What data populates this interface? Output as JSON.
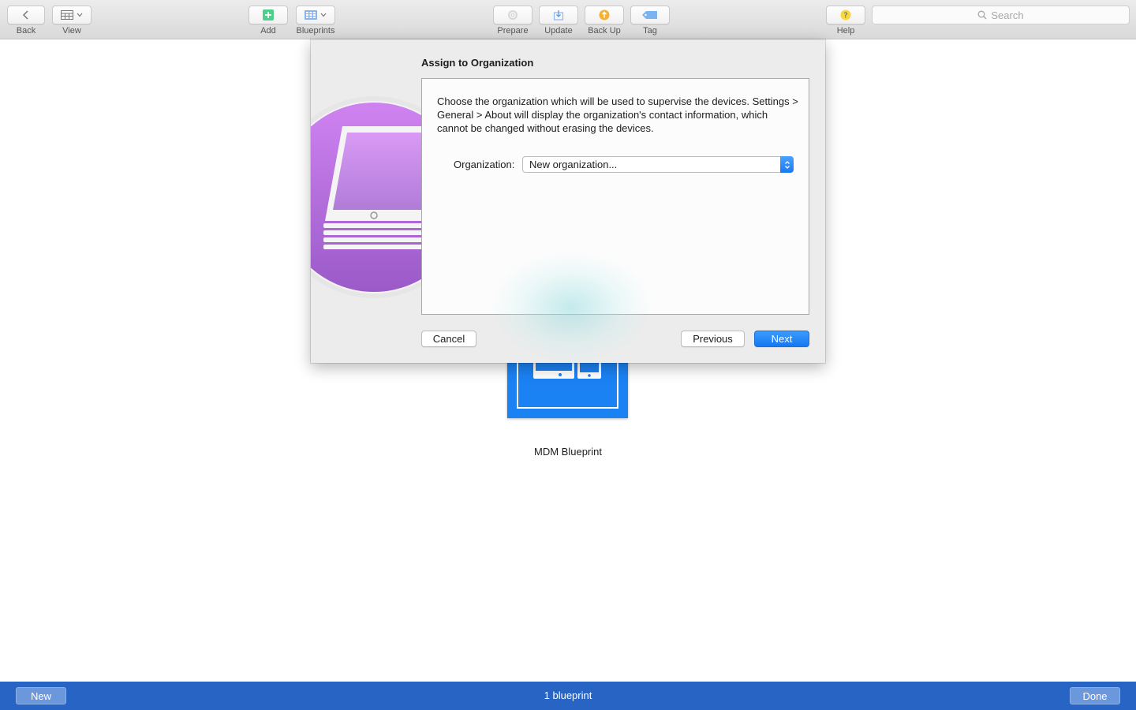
{
  "toolbar": {
    "back_label": "Back",
    "view_label": "View",
    "add_label": "Add",
    "blueprints_label": "Blueprints",
    "prepare_label": "Prepare",
    "update_label": "Update",
    "backup_label": "Back Up",
    "tag_label": "Tag",
    "help_label": "Help",
    "search_placeholder": "Search"
  },
  "main": {
    "blueprint_name": "MDM Blueprint"
  },
  "dialog": {
    "title": "Assign to Organization",
    "description": "Choose the organization which will be used to supervise the devices. Settings > General > About will display the organization's contact information, which cannot be changed without erasing the devices.",
    "organization_label": "Organization:",
    "organization_value": "New organization...",
    "cancel_label": "Cancel",
    "previous_label": "Previous",
    "next_label": "Next"
  },
  "bottom_bar": {
    "new_label": "New",
    "count_text": "1 blueprint",
    "done_label": "Done"
  },
  "colors": {
    "accent_blue": "#1478f0",
    "bottom_bar": "#2864c4",
    "blueprint_tile": "#1b82f3",
    "art_purple": "#b56ee0"
  }
}
